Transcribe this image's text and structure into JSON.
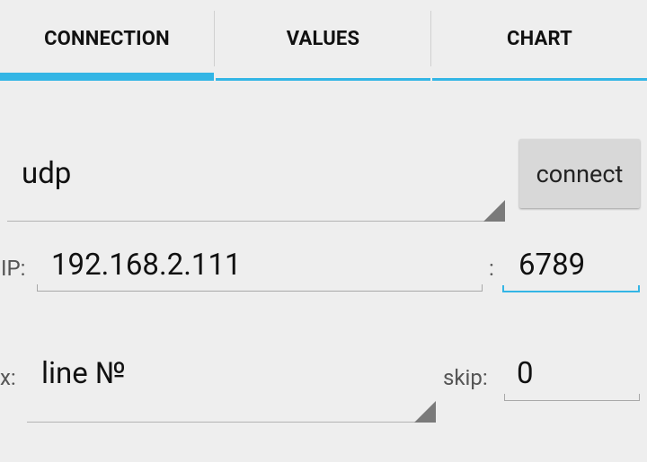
{
  "tabs": [
    {
      "label": "CONNECTION",
      "active": true
    },
    {
      "label": "VALUES",
      "active": false
    },
    {
      "label": "CHART",
      "active": false
    }
  ],
  "connection": {
    "protocol_value": "udp",
    "connect_label": "connect",
    "ip_label": "IP:",
    "ip_value": "192.168.2.111",
    "port_separator": ":",
    "port_value": "6789"
  },
  "chart_options": {
    "x_label": "x:",
    "x_value": "line №",
    "skip_label": "skip:",
    "skip_value": "0"
  },
  "colors": {
    "accent": "#33b5e5",
    "background": "#eeeeee"
  }
}
